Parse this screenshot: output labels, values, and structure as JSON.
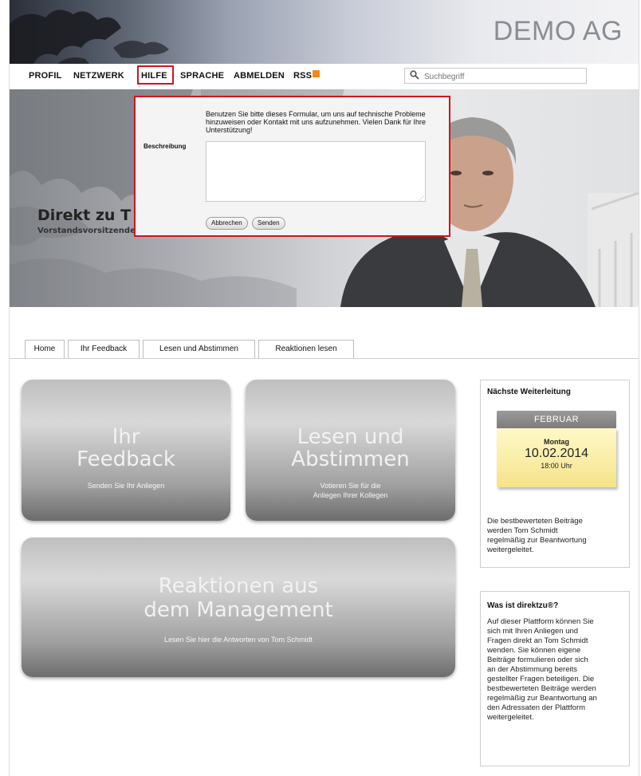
{
  "header": {
    "brand": "DEMO AG"
  },
  "nav": {
    "items": [
      "PROFIL",
      "NETZWERK",
      "HILFE",
      "SPRACHE",
      "ABMELDEN",
      "RSS"
    ],
    "search_placeholder": "Suchbegriff"
  },
  "hero": {
    "title": "Direkt zu T",
    "subtitle": "Vorstandsvorsitzende"
  },
  "dialog": {
    "intro": "Benutzen Sie bitte dieses Formular, um uns auf technische Probleme hinzuweisen oder Kontakt mit uns aufzunehmen. Vielen Dank für Ihre Unterstützung!",
    "field_label": "Beschreibung",
    "cancel_label": "Abbrechen",
    "send_label": "Senden"
  },
  "tabs": [
    "Home",
    "Ihr Feedback",
    "Lesen und Abstimmen",
    "Reaktionen lesen"
  ],
  "tiles": {
    "feedback": {
      "title_1": "Ihr",
      "title_2": "Feedback",
      "sub": "Senden Sie Ihr Anliegen"
    },
    "vote": {
      "title_1": "Lesen und",
      "title_2": "Abstimmen",
      "sub_1": "Votieren Sie für die",
      "sub_2": "Anliegen Ihrer Kollegen"
    },
    "reactions": {
      "title_1": "Reaktionen aus",
      "title_2": "dem Management",
      "sub": "Lesen Sie hier die Antworten von Tom Schmidt"
    }
  },
  "sidebar": {
    "next": {
      "heading": "Nächste Weiterleitung",
      "month": "FEBRUAR",
      "weekday": "Montag",
      "date": "10.02.2014",
      "time": "18:00 Uhr",
      "lines": [
        "Die bestbewerteten Beiträge",
        "werden Tom Schmidt",
        "regelmäßig zur Beantwortung",
        "weitergeleitet."
      ]
    },
    "about": {
      "heading": "Was ist direktzu®?",
      "lines": [
        "Auf dieser Plattform können Sie",
        "sich mit Ihren Anliegen und",
        "Fragen direkt an Tom Schmidt",
        "wenden. Sie können eigene",
        "Beiträge formulieren oder sich",
        "an der Abstimmung bereits",
        "gestellter Fragen beteiligen. Die",
        "bestbewerteten Beiträge werden",
        "regelmäßig zur Beantwortung an",
        "den Adressaten der Plattform",
        "weitergeleitet."
      ]
    }
  },
  "colors": {
    "highlight_red": "#d0141f",
    "tile_gray": "#9a9a9a",
    "note_yellow": "#f5e38a",
    "rss_orange": "#f08a19"
  }
}
